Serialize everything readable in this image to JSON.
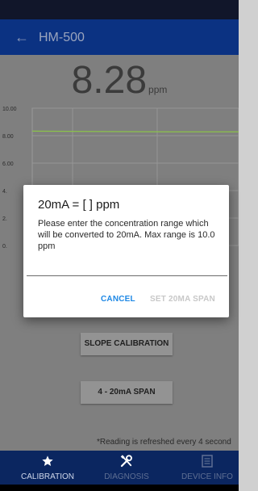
{
  "app": {
    "title": "HM-500"
  },
  "reading": {
    "value": "8.28",
    "unit": "ppm"
  },
  "chart_data": {
    "type": "line",
    "yticks": [
      "10.00",
      "8.00",
      "6.00",
      "4.",
      "2.",
      "0."
    ],
    "ylim": [
      0,
      10
    ],
    "grid": true,
    "series": [
      {
        "values": [
          8.33,
          8.3,
          8.28,
          8.28
        ]
      }
    ]
  },
  "buttons": {
    "slope_calibration": "SLOPE CALIBRATION",
    "span_4_20": "4 - 20mA SPAN"
  },
  "refresh_note": "*Reading is refreshed every 4 second",
  "dialog": {
    "title": "20mA = [   ] ppm",
    "message": "Please enter the concentration range which will be converted to 20mA. Max range is 10.0 ppm",
    "input_value": "",
    "cancel_label": "CANCEL",
    "confirm_label": "SET 20MA SPAN"
  },
  "bottom_nav": {
    "items": [
      {
        "label": "CALIBRATION",
        "icon": "star-icon",
        "active": true
      },
      {
        "label": "DIAGNOSIS",
        "icon": "tools-icon",
        "active": false
      },
      {
        "label": "DEVICE INFO",
        "icon": "document-icon",
        "active": false
      }
    ]
  },
  "colors": {
    "app_bar": "#0b3282",
    "accent": "#1e88e5",
    "series": "#8bc34a"
  }
}
